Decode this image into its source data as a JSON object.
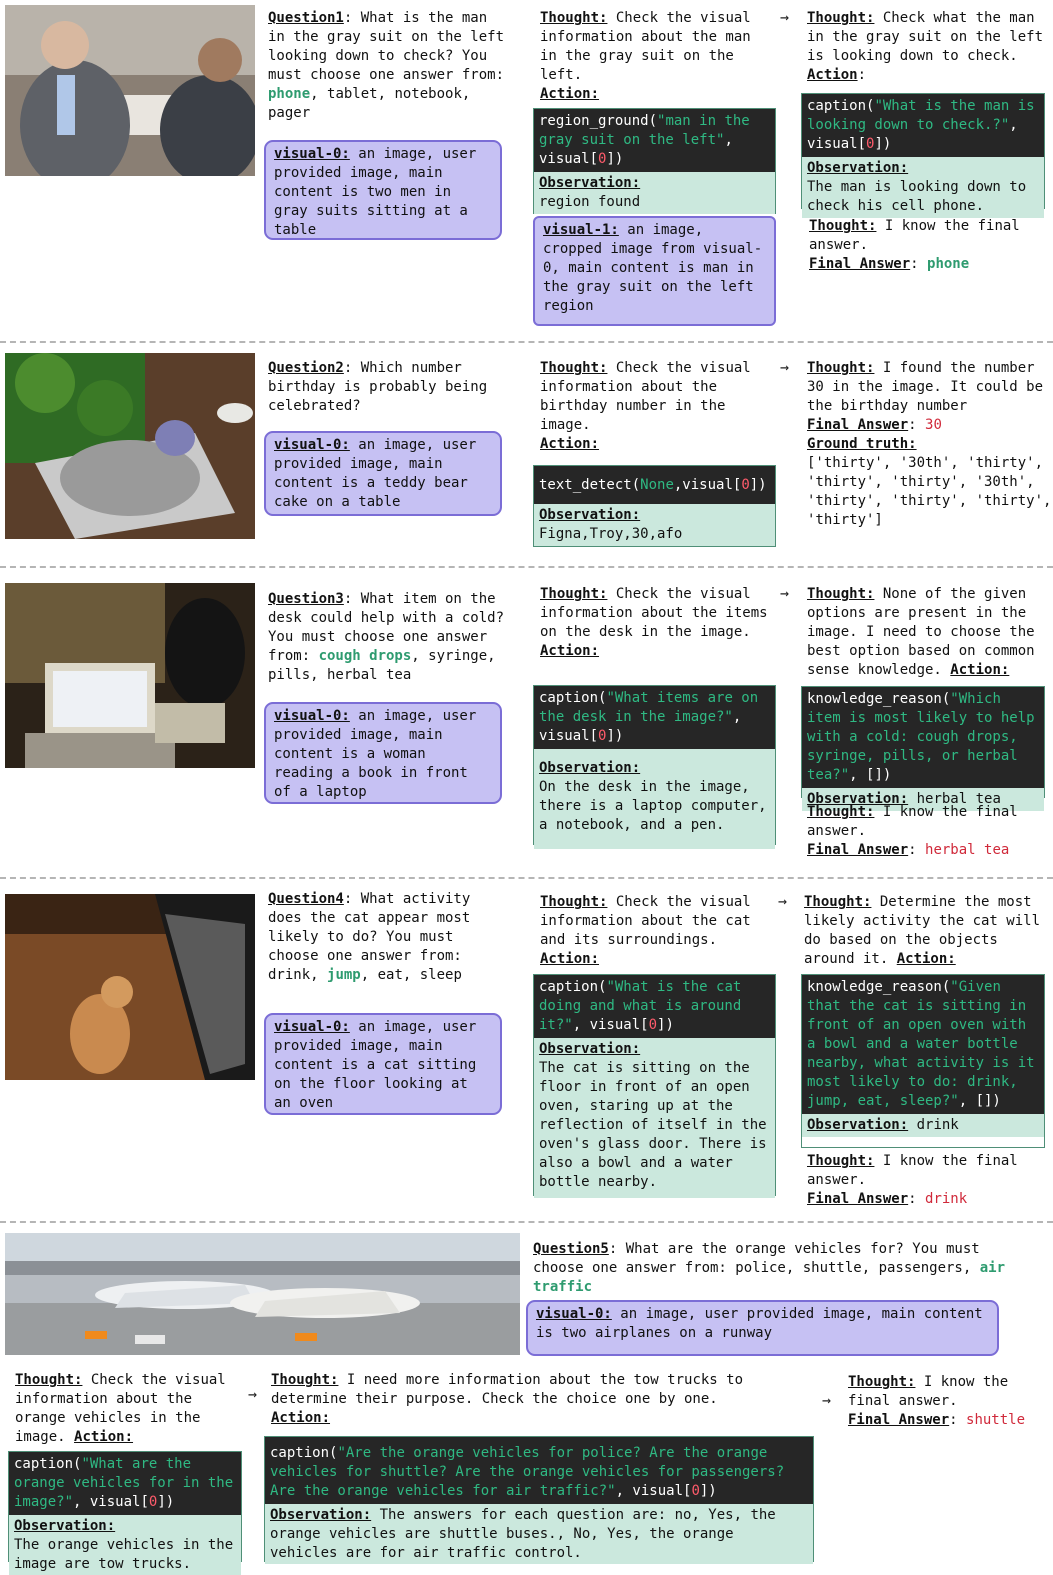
{
  "labels": {
    "thought": "Thought:",
    "action": "Action",
    "action_colon": "Action:",
    "observation": "Observation:",
    "final_answer": "Final Answer",
    "ground_truth": "Ground truth:"
  },
  "q1": {
    "title": "Question1",
    "text_a": ": What is the man in the gray suit on the left looking down to check? You must choose one answer from: ",
    "ans": "phone",
    "text_b": ", tablet, notebook, pager",
    "vis0_label": "visual-0:",
    "vis0_text": " an image, user provided image, main content is  two men in gray suits sitting at a table",
    "t1": " Check the visual information about the man in the gray suit on the left.",
    "code_fn": "region_ground(",
    "code_str": "\"man in the gray suit on the left\"",
    "code_mid": ", visual[",
    "code_num": "0",
    "code_end": "])",
    "obs1": "region found",
    "vis1_label": "visual-1:",
    "vis1_text": " an image, cropped image from visual-0, main content is man in the gray suit on the left region",
    "t2": " Check what the man in the gray suit on the left is looking down to check.",
    "code2_fn": "caption(",
    "code2_str": "\"What is the man is looking down to check.?\"",
    "code2_mid": ", visual[",
    "code2_num": "0",
    "code2_end": "])",
    "obs2": "The man is looking down to check his cell phone.",
    "t3": " I know the final answer.",
    "final": "phone"
  },
  "q2": {
    "title": "Question2",
    "text": ": Which number birthday is probably being celebrated?",
    "vis0_label": "visual-0:",
    "vis0_text": " an image, user provided image, main content is  a teddy bear cake on a table",
    "t1": " Check the visual information about the birthday number in the image.",
    "code_fn": "text_detect(",
    "code_str": "None",
    "code_mid": ",visual[",
    "code_num": "0",
    "code_end": "])",
    "obs1": "Figna,Troy,30,afo",
    "t2": " I found the number 30 in the image. It could be the birthday number",
    "final": "30",
    "gt": "['thirty', '30th', 'thirty', 'thirty', 'thirty', '30th', 'thirty', 'thirty', 'thirty', 'thirty']"
  },
  "q3": {
    "title": "Question3",
    "text_a": ": What item on the desk could help with a cold? You must choose one answer from: ",
    "ans": "cough drops",
    "text_b": ", syringe, pills, herbal tea",
    "vis0_label": "visual-0:",
    "vis0_text": " an image, user provided image, main content is  a woman reading a book in front of a laptop",
    "t1": " Check the visual information about the items on the desk in the image.",
    "code_fn": "caption(",
    "code_str": "\"What items are on the desk in the image?\"",
    "code_mid": ", visual[",
    "code_num": "0",
    "code_end": "])",
    "obs1": "On the desk in the image, there is a laptop computer, a notebook, and a pen.",
    "t2": " None of the given options are present in the image. I need to choose the best option based on common sense knowledge. ",
    "code2_fn": "knowledge_reason(",
    "code2_str": "\"Which item is most likely to help with a cold: cough drops, syringe, pills, or herbal tea?\"",
    "code2_end": ", [])",
    "obs2": " herbal tea",
    "t3": " I know the final answer.",
    "final": "herbal tea"
  },
  "q4": {
    "title": "Question4",
    "text_a": ": What activity does the cat appear most likely to do? You must choose one answer from: drink, ",
    "ans": "jump",
    "text_b": ", eat, sleep",
    "vis0_label": "visual-0:",
    "vis0_text": " an image, user provided image, main content is  a cat sitting on the floor looking at an oven",
    "t1": " Check the visual information about the cat and its surroundings.",
    "code_fn": "caption(",
    "code_str": "\"What is the cat doing and what is around it?\"",
    "code_mid": ", visual[",
    "code_num": "0",
    "code_end": "])",
    "obs1": "The cat is sitting on the floor in front of an open oven, staring up at the reflection of itself in the oven's glass door. There is also a bowl and a water bottle nearby.",
    "t2": " Determine the most likely activity the cat will do based on the objects around it. ",
    "code2_fn": "knowledge_reason(",
    "code2_str": "\"Given that the cat is sitting in front of an open oven with a bowl and a water bottle nearby, what activity is it most likely to do: drink, jump, eat, sleep?\"",
    "code2_end": ", [])",
    "obs2": " drink",
    "t3": " I know the final answer.",
    "final": "drink"
  },
  "q5": {
    "title": "Question5",
    "text_a": ": What are the orange vehicles for? You must choose one answer from: police, shuttle, passengers, ",
    "ans": "air traffic",
    "vis0_label": "visual-0:",
    "vis0_text": " an image, user provided image, main content is  two airplanes on a runway",
    "t1": " Check the visual information about the orange vehicles in the image. ",
    "code_fn": "caption(",
    "code_str": "\"What are the orange vehicles for in the image?\"",
    "code_mid": ", visual[",
    "code_num": "0",
    "code_end": "])",
    "obs1": "The orange vehicles in the image are tow trucks.",
    "t2": " I need more information about the tow trucks to determine their purpose. Check the choice one by one.",
    "code2_fn": "caption(",
    "code2_str": "\"Are the orange vehicles for police? Are the orange vehicles for shuttle? Are the orange vehicles for passengers? Are the orange vehicles for air traffic?\"",
    "code2_mid": ", visual[",
    "code2_num": "0",
    "code2_end": "])",
    "obs2": " The answers for each question are: no, Yes, the orange vehicles are shuttle buses., No, Yes, the orange vehicles are for air traffic control.",
    "t3": " I know the final answer.",
    "final": "shuttle"
  },
  "colors": {
    "visual_box": "#c6c1f3",
    "visual_border": "#7b6dd6",
    "code_bg": "#262626",
    "code_string": "#2fb983",
    "code_number": "#ff5b6b",
    "observation_bg": "#cbe8dd",
    "answer_green": "#2e9b6f",
    "answer_red": "#d0293a"
  }
}
